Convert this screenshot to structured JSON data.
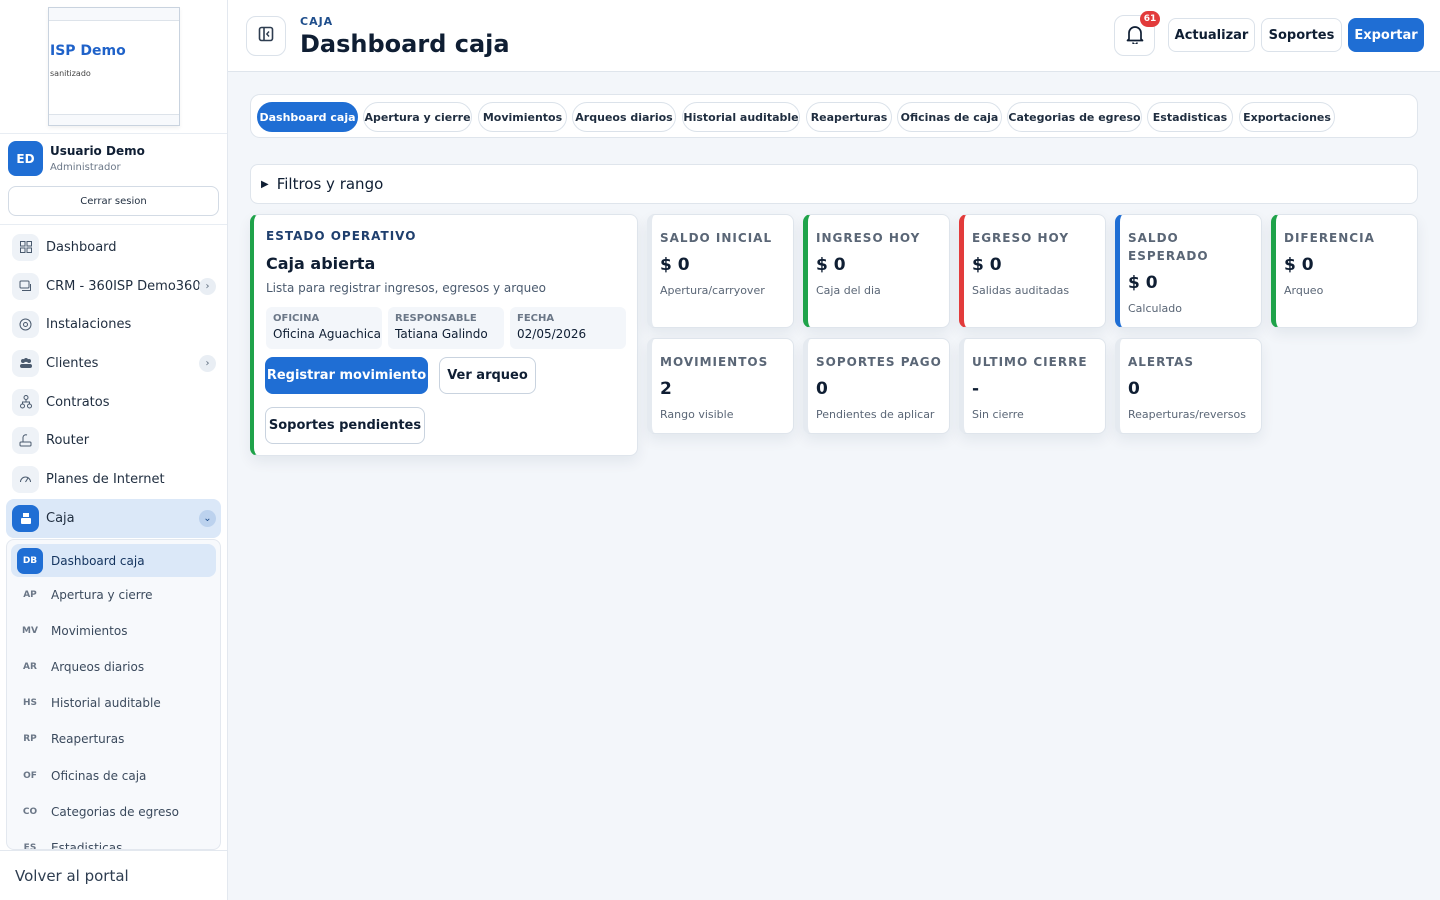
{
  "sidebar": {
    "logo_title": "ISP Demo",
    "logo_subtitle": "sanitizado",
    "user": {
      "initials": "ED",
      "name": "Usuario Demo",
      "role": "Administrador"
    },
    "logout_label": "Cerrar sesion",
    "nav": [
      {
        "label": "Dashboard",
        "icon": "grid-icon"
      },
      {
        "label": "CRM - 360ISP Demo360",
        "icon": "chat-icon",
        "has_chevron": true
      },
      {
        "label": "Instalaciones",
        "icon": "target-icon"
      },
      {
        "label": "Clientes",
        "icon": "users-icon",
        "has_chevron": true
      },
      {
        "label": "Contratos",
        "icon": "network-icon"
      },
      {
        "label": "Router",
        "icon": "router-icon"
      },
      {
        "label": "Planes de Internet",
        "icon": "speed-icon"
      },
      {
        "label": "Caja",
        "icon": "cashbox-icon",
        "has_chevron": true,
        "active": true
      }
    ],
    "subnav": [
      {
        "code": "DB",
        "label": "Dashboard caja",
        "active": true
      },
      {
        "code": "AP",
        "label": "Apertura y cierre"
      },
      {
        "code": "MV",
        "label": "Movimientos"
      },
      {
        "code": "AR",
        "label": "Arqueos diarios"
      },
      {
        "code": "HS",
        "label": "Historial auditable"
      },
      {
        "code": "RP",
        "label": "Reaperturas"
      },
      {
        "code": "OF",
        "label": "Oficinas de caja"
      },
      {
        "code": "CO",
        "label": "Categorias de egreso"
      },
      {
        "code": "ES",
        "label": "Estadisticas"
      }
    ],
    "back_label": "Volver al portal"
  },
  "header": {
    "eyebrow": "CAJA",
    "title": "Dashboard caja",
    "notification_count": "61",
    "buttons": {
      "refresh": "Actualizar",
      "supports": "Soportes",
      "export": "Exportar"
    }
  },
  "tabs": [
    "Dashboard caja",
    "Apertura y cierre",
    "Movimientos",
    "Arqueos diarios",
    "Historial auditable",
    "Reaperturas",
    "Oficinas de caja",
    "Categorias de egreso",
    "Estadisticas",
    "Exportaciones"
  ],
  "filters_label": "Filtros y rango",
  "status": {
    "eyebrow": "ESTADO OPERATIVO",
    "title": "Caja abierta",
    "description": "Lista para registrar ingresos, egresos y arqueo",
    "info": [
      {
        "key": "OFICINA",
        "value": "Oficina Aguachica"
      },
      {
        "key": "RESPONSABLE",
        "value": "Tatiana Galindo"
      },
      {
        "key": "FECHA",
        "value": "02/05/2026"
      }
    ],
    "buttons": {
      "register": "Registrar movimiento",
      "arqueo": "Ver arqueo",
      "pending": "Soportes pendientes"
    }
  },
  "kpis": [
    {
      "title": "SALDO INICIAL",
      "value": "$ 0",
      "sub": "Apertura/carryover",
      "accent": "none"
    },
    {
      "title": "INGRESO HOY",
      "value": "$ 0",
      "sub": "Caja del dia",
      "accent": "green"
    },
    {
      "title": "EGRESO HOY",
      "value": "$ 0",
      "sub": "Salidas auditadas",
      "accent": "red"
    },
    {
      "title": "SALDO ESPERADO",
      "value": "$ 0",
      "sub": "Calculado",
      "accent": "blue"
    },
    {
      "title": "DIFERENCIA",
      "value": "$ 0",
      "sub": "Arqueo",
      "accent": "green"
    },
    {
      "title": "MOVIMIENTOS",
      "value": "2",
      "sub": "Rango visible",
      "accent": "none"
    },
    {
      "title": "SOPORTES PAGO",
      "value": "0",
      "sub": "Pendientes de aplicar",
      "accent": "none"
    },
    {
      "title": "ULTIMO CIERRE",
      "value": "-",
      "sub": "Sin cierre",
      "accent": "none"
    },
    {
      "title": "ALERTAS",
      "value": "0",
      "sub": "Reaperturas/reversos",
      "accent": "none"
    }
  ],
  "colors": {
    "primary": "#1f6ed4",
    "success": "#1fa34a",
    "danger": "#e23b3b",
    "background": "#f3f6fa"
  }
}
